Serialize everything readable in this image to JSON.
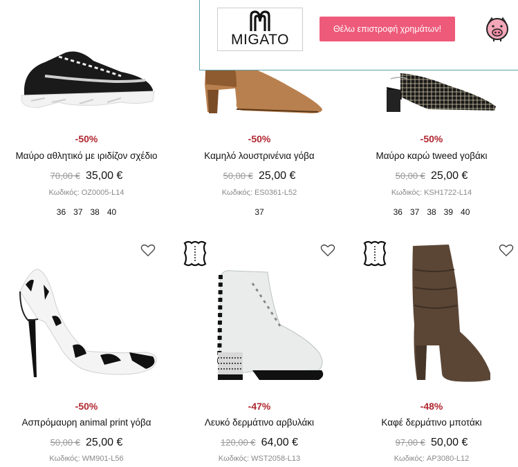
{
  "banner": {
    "brand": "MIGATO",
    "refund_button": "Θέλω επιστροφή χρημάτων!",
    "piggy_icon": "piggy-bank-icon"
  },
  "products": [
    {
      "discount": "-50%",
      "title": "Μαύρο αθλητικό με ιριδίζον σχέδιο",
      "old_price": "70,00 €",
      "new_price": "35,00 €",
      "code": "Κωδικός: OZ0005-L14",
      "sizes": [
        "36",
        "37",
        "38",
        "40"
      ]
    },
    {
      "discount": "-50%",
      "title": "Καμηλό λουστρινένια γόβα",
      "old_price": "50,00 €",
      "new_price": "25,00 €",
      "code": "Κωδικός: ES0361-L52",
      "sizes": [
        "37"
      ]
    },
    {
      "discount": "-50%",
      "title": "Μαύρο καρώ tweed γοβάκι",
      "old_price": "50,00 €",
      "new_price": "25,00 €",
      "code": "Κωδικός: KSH1722-L14",
      "sizes": [
        "36",
        "37",
        "38",
        "39",
        "40"
      ]
    },
    {
      "discount": "-50%",
      "title": "Ασπρόμαυρη animal print γόβα",
      "old_price": "50,00 €",
      "new_price": "25,00 €",
      "code": "Κωδικός: WM901-L56"
    },
    {
      "discount": "-47%",
      "title": "Λευκό δερμάτινο αρβυλάκι",
      "old_price": "120,00 €",
      "new_price": "64,00 €",
      "code": "Κωδικός: WST2058-L13"
    },
    {
      "discount": "-48%",
      "title": "Καφέ δερμάτινο μποτάκι",
      "old_price": "97,00 €",
      "new_price": "50,00 €",
      "code": "Κωδικός: AP3080-L12"
    }
  ],
  "colors": {
    "discount": "#b0262f",
    "refund_button_bg": "#ee5a7a",
    "banner_border": "#5aa0a8"
  }
}
